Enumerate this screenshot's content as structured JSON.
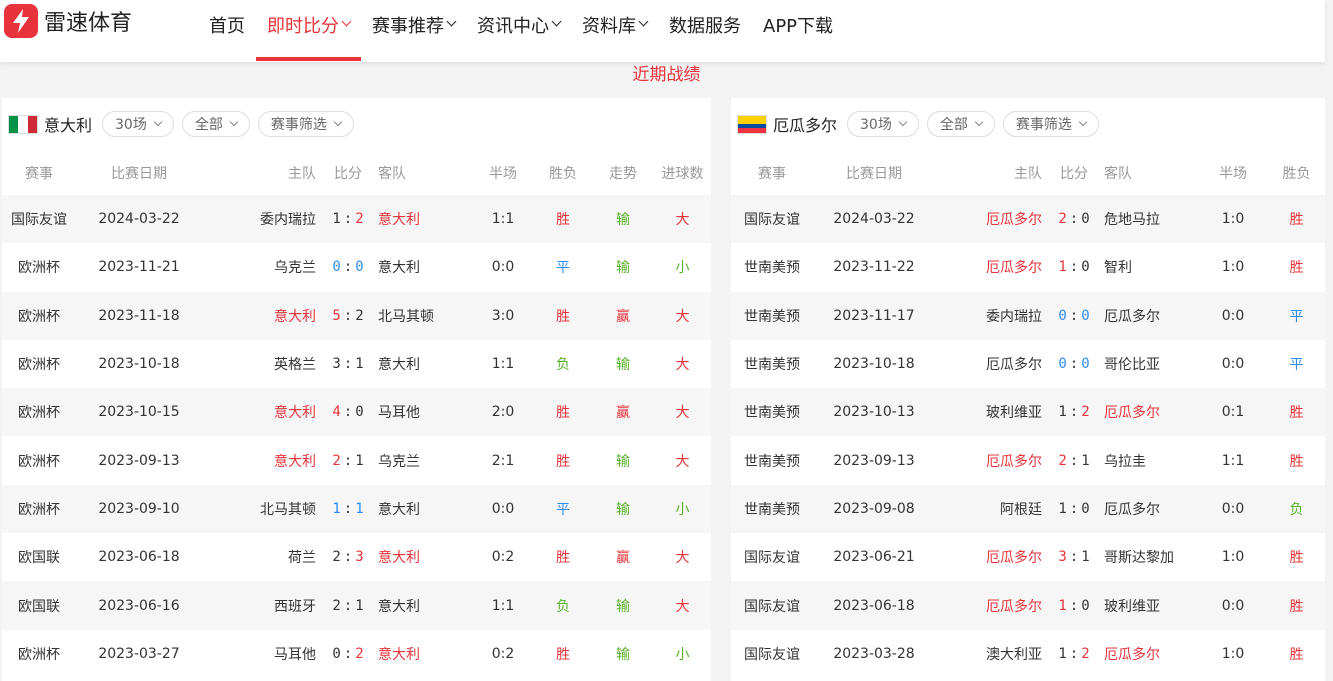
{
  "brand": {
    "name": "雷速体育"
  },
  "nav": [
    {
      "label": "首页",
      "dropdown": false,
      "active": false
    },
    {
      "label": "即时比分",
      "dropdown": true,
      "active": true
    },
    {
      "label": "赛事推荐",
      "dropdown": true,
      "active": false
    },
    {
      "label": "资讯中心",
      "dropdown": true,
      "active": false
    },
    {
      "label": "资料库",
      "dropdown": true,
      "active": false
    },
    {
      "label": "数据服务",
      "dropdown": false,
      "active": false
    },
    {
      "label": "APP下载",
      "dropdown": false,
      "active": false
    }
  ],
  "section_title": "近期战绩",
  "colors": {
    "accent": "#e8333b",
    "draw": "#2d8cf0",
    "lose": "#7ac143"
  },
  "left": {
    "team": "意大利",
    "flag": "italy-flag-icon",
    "filters": {
      "count": "30场",
      "scope": "全部",
      "event": "赛事筛选"
    },
    "headers": [
      "赛事",
      "比赛日期",
      "主队",
      "比分",
      "客队",
      "半场",
      "胜负",
      "走势",
      "进球数"
    ],
    "rows": [
      {
        "event": "国际友谊",
        "date": "2024-03-22",
        "home": "委内瑞拉",
        "hs": "1",
        "as": "2",
        "away": "意大利",
        "ht": "1:1",
        "res": "胜",
        "trend": "输",
        "goals": "大",
        "focus": "away"
      },
      {
        "event": "欧洲杯",
        "date": "2023-11-21",
        "home": "乌克兰",
        "hs": "0",
        "as": "0",
        "away": "意大利",
        "ht": "0:0",
        "res": "平",
        "trend": "输",
        "goals": "小",
        "focus": "draw"
      },
      {
        "event": "欧洲杯",
        "date": "2023-11-18",
        "home": "意大利",
        "hs": "5",
        "as": "2",
        "away": "北马其顿",
        "ht": "3:0",
        "res": "胜",
        "trend": "赢",
        "goals": "大",
        "focus": "home"
      },
      {
        "event": "欧洲杯",
        "date": "2023-10-18",
        "home": "英格兰",
        "hs": "3",
        "as": "1",
        "away": "意大利",
        "ht": "1:1",
        "res": "负",
        "trend": "输",
        "goals": "大",
        "focus": "none"
      },
      {
        "event": "欧洲杯",
        "date": "2023-10-15",
        "home": "意大利",
        "hs": "4",
        "as": "0",
        "away": "马耳他",
        "ht": "2:0",
        "res": "胜",
        "trend": "赢",
        "goals": "大",
        "focus": "home"
      },
      {
        "event": "欧洲杯",
        "date": "2023-09-13",
        "home": "意大利",
        "hs": "2",
        "as": "1",
        "away": "乌克兰",
        "ht": "2:1",
        "res": "胜",
        "trend": "输",
        "goals": "大",
        "focus": "home"
      },
      {
        "event": "欧洲杯",
        "date": "2023-09-10",
        "home": "北马其顿",
        "hs": "1",
        "as": "1",
        "away": "意大利",
        "ht": "0:0",
        "res": "平",
        "trend": "输",
        "goals": "小",
        "focus": "draw"
      },
      {
        "event": "欧国联",
        "date": "2023-06-18",
        "home": "荷兰",
        "hs": "2",
        "as": "3",
        "away": "意大利",
        "ht": "0:2",
        "res": "胜",
        "trend": "赢",
        "goals": "大",
        "focus": "away"
      },
      {
        "event": "欧国联",
        "date": "2023-06-16",
        "home": "西班牙",
        "hs": "2",
        "as": "1",
        "away": "意大利",
        "ht": "1:1",
        "res": "负",
        "trend": "输",
        "goals": "大",
        "focus": "none"
      },
      {
        "event": "欧洲杯",
        "date": "2023-03-27",
        "home": "马耳他",
        "hs": "0",
        "as": "2",
        "away": "意大利",
        "ht": "0:2",
        "res": "胜",
        "trend": "输",
        "goals": "小",
        "focus": "away"
      }
    ]
  },
  "right": {
    "team": "厄瓜多尔",
    "flag": "ecuador-flag-icon",
    "filters": {
      "count": "30场",
      "scope": "全部",
      "event": "赛事筛选"
    },
    "headers": [
      "赛事",
      "比赛日期",
      "主队",
      "比分",
      "客队",
      "半场",
      "胜负"
    ],
    "rows": [
      {
        "event": "国际友谊",
        "date": "2024-03-22",
        "home": "厄瓜多尔",
        "hs": "2",
        "as": "0",
        "away": "危地马拉",
        "ht": "1:0",
        "res": "胜",
        "focus": "home"
      },
      {
        "event": "世南美预",
        "date": "2023-11-22",
        "home": "厄瓜多尔",
        "hs": "1",
        "as": "0",
        "away": "智利",
        "ht": "1:0",
        "res": "胜",
        "focus": "home"
      },
      {
        "event": "世南美预",
        "date": "2023-11-17",
        "home": "委内瑞拉",
        "hs": "0",
        "as": "0",
        "away": "厄瓜多尔",
        "ht": "0:0",
        "res": "平",
        "focus": "draw"
      },
      {
        "event": "世南美预",
        "date": "2023-10-18",
        "home": "厄瓜多尔",
        "hs": "0",
        "as": "0",
        "away": "哥伦比亚",
        "ht": "0:0",
        "res": "平",
        "focus": "draw"
      },
      {
        "event": "世南美预",
        "date": "2023-10-13",
        "home": "玻利维亚",
        "hs": "1",
        "as": "2",
        "away": "厄瓜多尔",
        "ht": "0:1",
        "res": "胜",
        "focus": "away"
      },
      {
        "event": "世南美预",
        "date": "2023-09-13",
        "home": "厄瓜多尔",
        "hs": "2",
        "as": "1",
        "away": "乌拉圭",
        "ht": "1:1",
        "res": "胜",
        "focus": "home"
      },
      {
        "event": "世南美预",
        "date": "2023-09-08",
        "home": "阿根廷",
        "hs": "1",
        "as": "0",
        "away": "厄瓜多尔",
        "ht": "0:0",
        "res": "负",
        "focus": "none"
      },
      {
        "event": "国际友谊",
        "date": "2023-06-21",
        "home": "厄瓜多尔",
        "hs": "3",
        "as": "1",
        "away": "哥斯达黎加",
        "ht": "1:0",
        "res": "胜",
        "focus": "home"
      },
      {
        "event": "国际友谊",
        "date": "2023-06-18",
        "home": "厄瓜多尔",
        "hs": "1",
        "as": "0",
        "away": "玻利维亚",
        "ht": "0:0",
        "res": "胜",
        "focus": "home"
      },
      {
        "event": "国际友谊",
        "date": "2023-03-28",
        "home": "澳大利亚",
        "hs": "1",
        "as": "2",
        "away": "厄瓜多尔",
        "ht": "1:0",
        "res": "胜",
        "focus": "away"
      }
    ]
  }
}
